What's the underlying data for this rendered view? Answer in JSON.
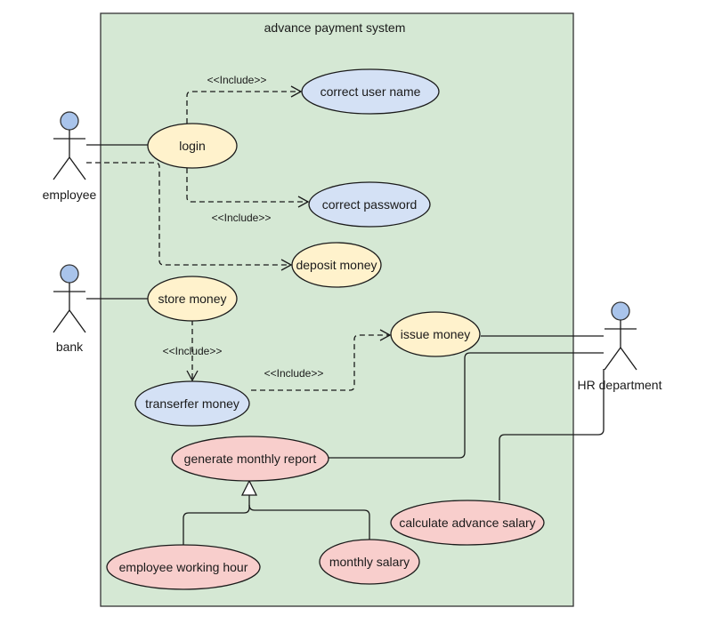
{
  "diagram": {
    "type": "use-case",
    "system": {
      "title": "advance payment system",
      "fill": "#d5e8d4",
      "stroke": "#333333"
    },
    "colors": {
      "actor_head": "#a9c4eb",
      "yellow_usecase": "#fff2cc",
      "blue_usecase": "#d4e1f5",
      "red_usecase": "#f8cecc"
    },
    "actors": [
      {
        "id": "employee",
        "label": "employee"
      },
      {
        "id": "bank",
        "label": "bank"
      },
      {
        "id": "hr",
        "label": "HR department"
      }
    ],
    "use_cases": [
      {
        "id": "login",
        "label": "login",
        "color": "yellow"
      },
      {
        "id": "correct_user_name",
        "label": "correct user name",
        "color": "blue"
      },
      {
        "id": "correct_password",
        "label": "correct password",
        "color": "blue"
      },
      {
        "id": "deposit_money",
        "label": "deposit money",
        "color": "yellow"
      },
      {
        "id": "store_money",
        "label": "store money",
        "color": "yellow"
      },
      {
        "id": "issue_money",
        "label": "issue money",
        "color": "yellow"
      },
      {
        "id": "transfer_money",
        "label": "transerfer money",
        "color": "blue"
      },
      {
        "id": "generate_monthly_report",
        "label": "generate monthly report",
        "color": "red"
      },
      {
        "id": "calculate_advance_salary",
        "label": "calculate advance salary",
        "color": "red"
      },
      {
        "id": "employee_working_hour",
        "label": "employee working hour",
        "color": "red"
      },
      {
        "id": "monthly_salary",
        "label": "monthly salary",
        "color": "red"
      }
    ],
    "relations": [
      {
        "from": "employee",
        "to": "login",
        "kind": "association"
      },
      {
        "from": "employee",
        "to": "deposit_money",
        "kind": "dependency"
      },
      {
        "from": "login",
        "to": "correct_user_name",
        "kind": "include",
        "label": "<<Include>>"
      },
      {
        "from": "login",
        "to": "correct_password",
        "kind": "include",
        "label": "<<Include>>"
      },
      {
        "from": "bank",
        "to": "store_money",
        "kind": "association"
      },
      {
        "from": "store_money",
        "to": "transfer_money",
        "kind": "include",
        "label": "<<Include>>"
      },
      {
        "from": "transfer_money",
        "to": "issue_money",
        "kind": "include",
        "label": "<<Include>>"
      },
      {
        "from": "hr",
        "to": "issue_money",
        "kind": "association"
      },
      {
        "from": "hr",
        "to": "generate_monthly_report",
        "kind": "association"
      },
      {
        "from": "hr",
        "to": "calculate_advance_salary",
        "kind": "association"
      },
      {
        "from": "employee_working_hour",
        "to": "generate_monthly_report",
        "kind": "generalization"
      },
      {
        "from": "monthly_salary",
        "to": "generate_monthly_report",
        "kind": "generalization"
      }
    ]
  }
}
